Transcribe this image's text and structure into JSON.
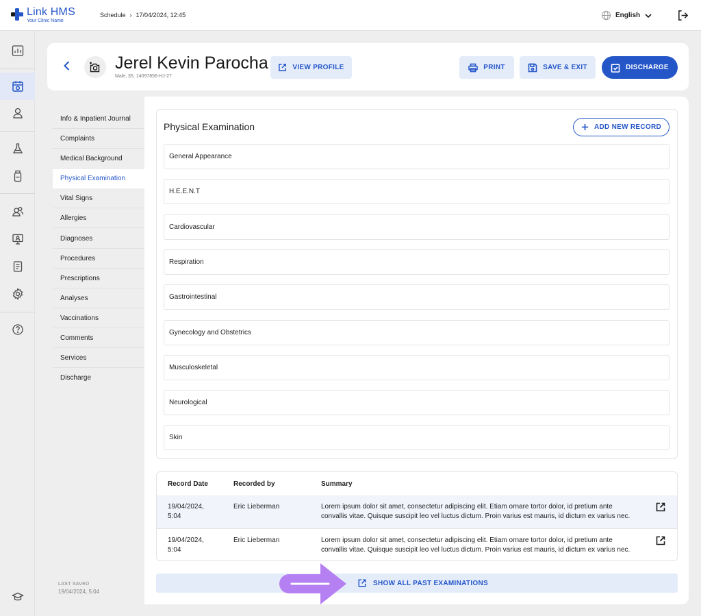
{
  "app": {
    "name": "Link HMS",
    "clinic": "Your Clinic Name"
  },
  "breadcrumb": {
    "section": "Schedule",
    "current": "17/04/2024, 12:45"
  },
  "language": "English",
  "rail_icons": [
    "dashboard-icon",
    "calendar-icon",
    "user-icon",
    "flask-icon",
    "medicine-bottle-icon",
    "users-icon",
    "monitor-user-icon",
    "clipboard-icon",
    "settings-icon",
    "help-icon",
    "graduation-cap-icon"
  ],
  "patient": {
    "name": "Jerel Kevin Parocha",
    "meta": "Male, 35, 14097856-HJ-27"
  },
  "header_buttons": {
    "view_profile": "VIEW PROFILE",
    "print": "PRINT",
    "save_exit": "SAVE & EXIT",
    "discharge": "DISCHARGE"
  },
  "subnav": {
    "active": "Physical Examination",
    "items": [
      "Info & Inpatient Journal",
      "Complaints",
      "Medical Background",
      "Physical Examination",
      "Vital Signs",
      "Allergies",
      "Diagnoses",
      "Procedures",
      "Prescriptions",
      "Analyses",
      "Vaccinations",
      "Comments",
      "Services",
      "Discharge"
    ]
  },
  "last_saved": {
    "label": "LAST SAVED",
    "value": "19/04/2024, 5:04"
  },
  "exam": {
    "title": "Physical Examination",
    "add_button": "ADD NEW RECORD",
    "sections": [
      "General Appearance",
      "H.E.E.N.T",
      "Cardiovascular",
      "Respiration",
      "Gastrointestinal",
      "Gynecology and Obstetrics",
      "Musculoskeletal",
      "Neurological",
      "Skin"
    ]
  },
  "records": {
    "headers": [
      "Record Date",
      "Recorded by",
      "Summary"
    ],
    "rows": [
      {
        "date_line1": "19/04/2024,",
        "date_line2": "5:04",
        "by": "Eric Lieberman",
        "summary_line1": "Lorem ipsum dolor sit amet, consectetur adipiscing elit. Etiam ornare tortor dolor, id pretium ante",
        "summary_line2": "convallis vitae. Quisque suscipit leo vel luctus dictum. Proin varius est mauris, id dictum ex varius nec."
      },
      {
        "date_line1": "19/04/2024,",
        "date_line2": "5:04",
        "by": "Eric Lieberman",
        "summary_line1": "Lorem ipsum dolor sit amet, consectetur adipiscing elit. Etiam ornare tortor dolor, id pretium ante",
        "summary_line2": "convallis vitae. Quisque suscipit leo vel luctus dictum. Proin varius est mauris, id dictum ex varius nec."
      }
    ]
  },
  "show_all": "SHOW ALL PAST EXAMINATIONS",
  "colors": {
    "accent": "#2456c8",
    "accent_light": "#e4ecfa",
    "arrow": "#b07ef0"
  }
}
